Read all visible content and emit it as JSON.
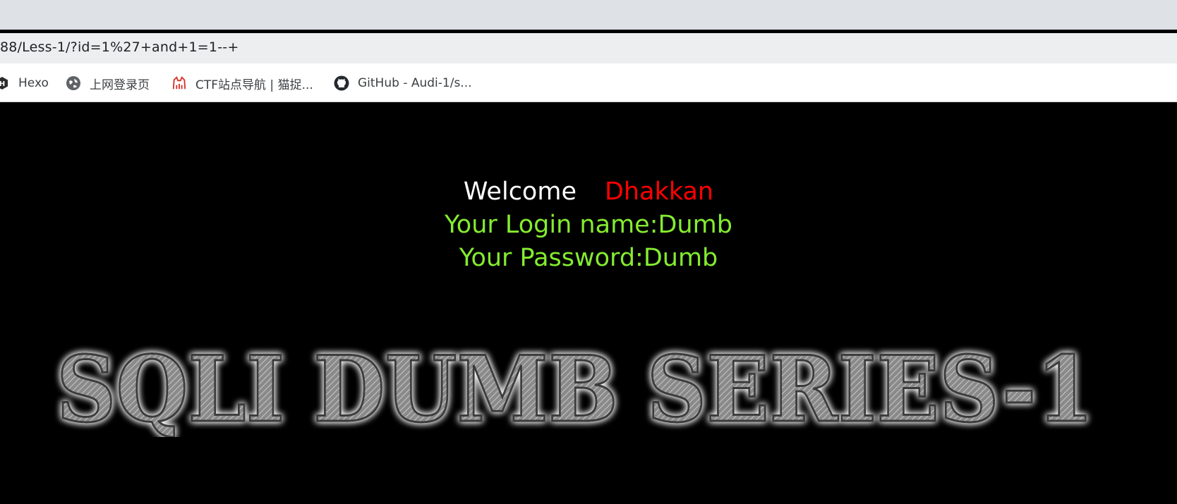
{
  "browser": {
    "address": "88/Less-1/?id=1%27+and+1=1--+",
    "bookmarks": [
      {
        "label": "Hexo",
        "icon": "hexo-icon"
      },
      {
        "label": "上网登录页",
        "icon": "globe-icon"
      },
      {
        "label": "CTF站点导航 | 猫捉...",
        "icon": "cat-icon"
      },
      {
        "label": "GitHub - Audi-1/s...",
        "icon": "github-icon"
      }
    ]
  },
  "page": {
    "welcome_word": "Welcome",
    "welcome_name": "Dhakkan",
    "login_line": "Your Login name:Dumb",
    "password_line": "Your Password:Dumb",
    "banner_text": "SQLI DUMB SERIES-1"
  },
  "colors": {
    "background": "#000000",
    "welcome": "#ffffff",
    "name": "#ff0000",
    "info": "#84ec2f"
  }
}
